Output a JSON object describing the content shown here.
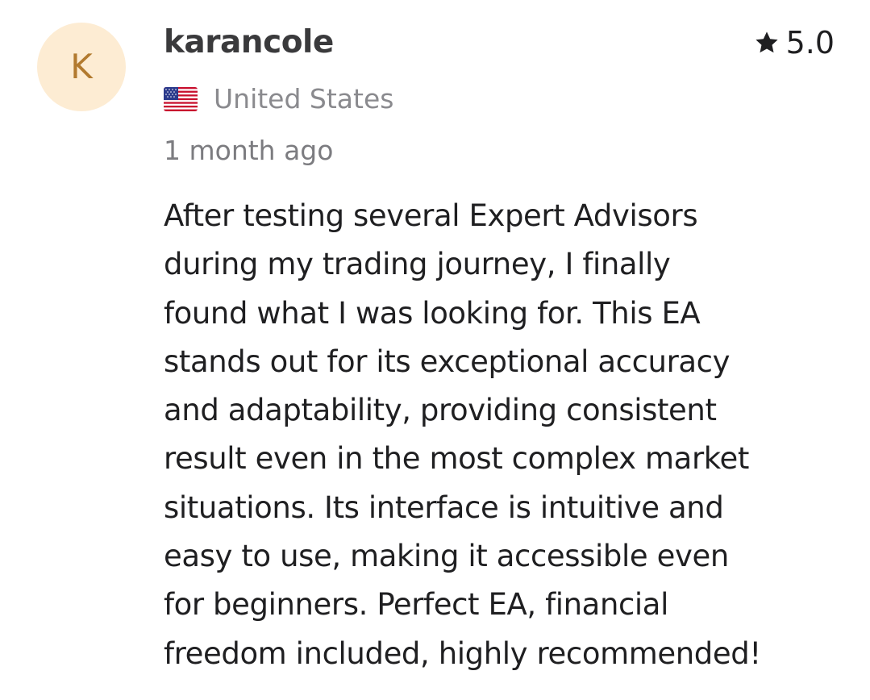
{
  "review": {
    "avatar_initial": "K",
    "username": "karancole",
    "rating": "5.0",
    "rating_icon": "star-icon",
    "flag_icon": "us-flag-icon",
    "country": "United States",
    "timestamp": "1 month ago",
    "body_lines": [
      "After testing several Expert Advisors",
      "during my trading journey, I finally",
      "found what I was looking for. This EA",
      "stands out for its exceptional accuracy",
      "and adaptability, providing consistent",
      "result even in the most complex market",
      "situations. Its interface is intuitive and",
      "easy to use, making it accessible even",
      "for beginners. Perfect EA, financial",
      "freedom included, highly recommended!"
    ]
  },
  "colors": {
    "avatar_bg": "#fdecd3",
    "avatar_letter": "#b27a2f",
    "username": "#3a3a3c",
    "secondary_text": "#8a8a8e",
    "body_text": "#1f1f21"
  }
}
